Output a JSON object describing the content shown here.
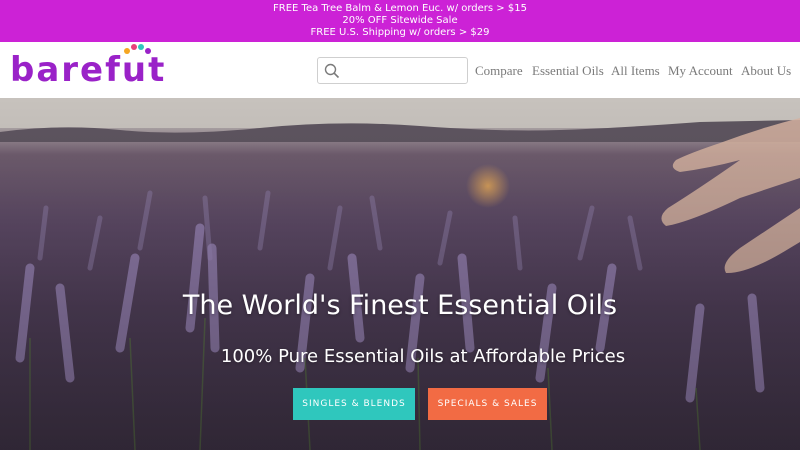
{
  "promo": {
    "line1": "FREE Tea Tree Balm & Lemon Euc. w/ orders > $15",
    "line2": "20% OFF Sitewide Sale",
    "line3": "FREE U.S. Shipping w/ orders > $29"
  },
  "logo": {
    "part1": "baref",
    "part2": "t"
  },
  "search": {
    "placeholder": ""
  },
  "nav": [
    "Compare",
    "Essential Oils",
    "All Items",
    "My Account",
    "About Us"
  ],
  "hero": {
    "title": "The World's Finest Essential Oils",
    "subtitle": "100% Pure Essential Oils at Affordable Prices",
    "button_singles": "SINGLES & BLENDS",
    "button_specials": "SPECIALS & SALES"
  },
  "colors": {
    "promo_bg": "#cc22d6",
    "logo": "#9a22c8",
    "singles_button": "#2fc7bd",
    "specials_button": "#f26b44",
    "logo_dots": [
      "#f5a623",
      "#e8417a",
      "#2fc7bd",
      "#9a22c8"
    ]
  }
}
